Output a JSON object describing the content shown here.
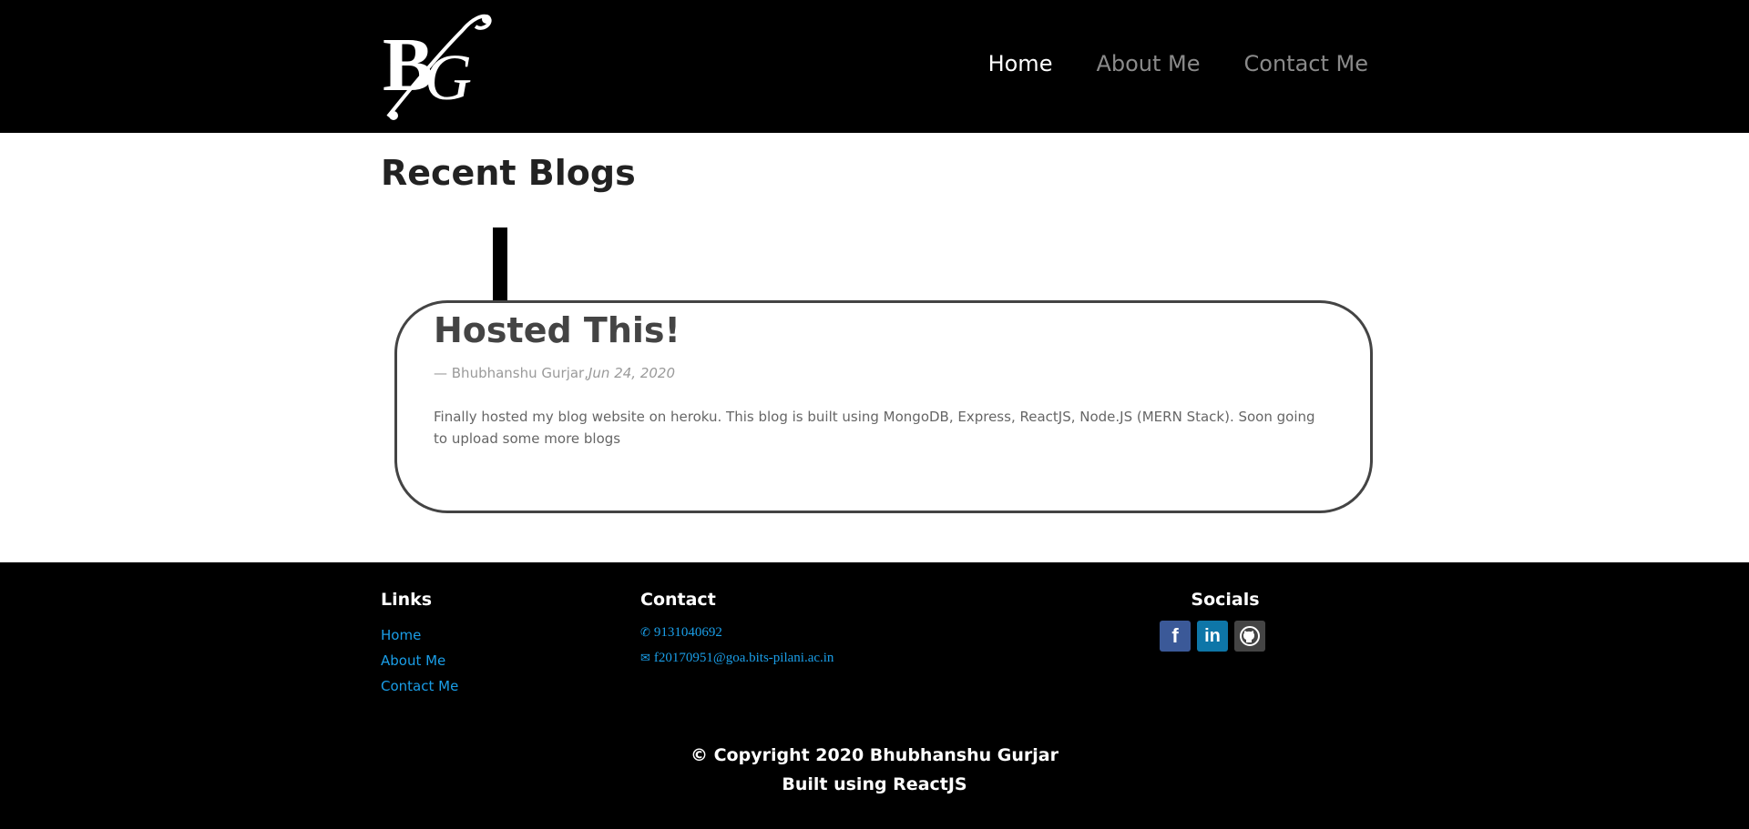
{
  "header": {
    "logo_text": "BG",
    "nav": [
      {
        "label": "Home",
        "active": true
      },
      {
        "label": "About Me",
        "active": false
      },
      {
        "label": "Contact Me",
        "active": false
      }
    ]
  },
  "main": {
    "title": "Recent Blogs",
    "blogs": [
      {
        "title": "Hosted This!",
        "author": "— Bhubhanshu Gurjar,",
        "date": "Jun 24, 2020",
        "body": "Finally hosted my blog website on heroku. This blog is built using MongoDB, Express, ReactJS, Node.JS (MERN Stack). Soon going to upload some more blogs"
      }
    ]
  },
  "footer": {
    "links_title": "Links",
    "links": [
      "Home",
      "About Me",
      "Contact Me"
    ],
    "contact_title": "Contact",
    "phone": "9131040692",
    "email": "f20170951@goa.bits-pilani.ac.in",
    "socials_title": "Socials",
    "socials": [
      {
        "name": "facebook-icon",
        "glyph": "f"
      },
      {
        "name": "linkedin-icon",
        "glyph": "in"
      },
      {
        "name": "github-icon",
        "glyph": ""
      }
    ],
    "copyright": "© Copyright 2020 Bhubhanshu Gurjar",
    "built_with": "Built using ReactJS"
  },
  "colors": {
    "header_bg": "#000000",
    "link_blue": "#1a9ee8",
    "nav_active": "#ffffff",
    "nav_inactive": "#8a8a8a"
  }
}
